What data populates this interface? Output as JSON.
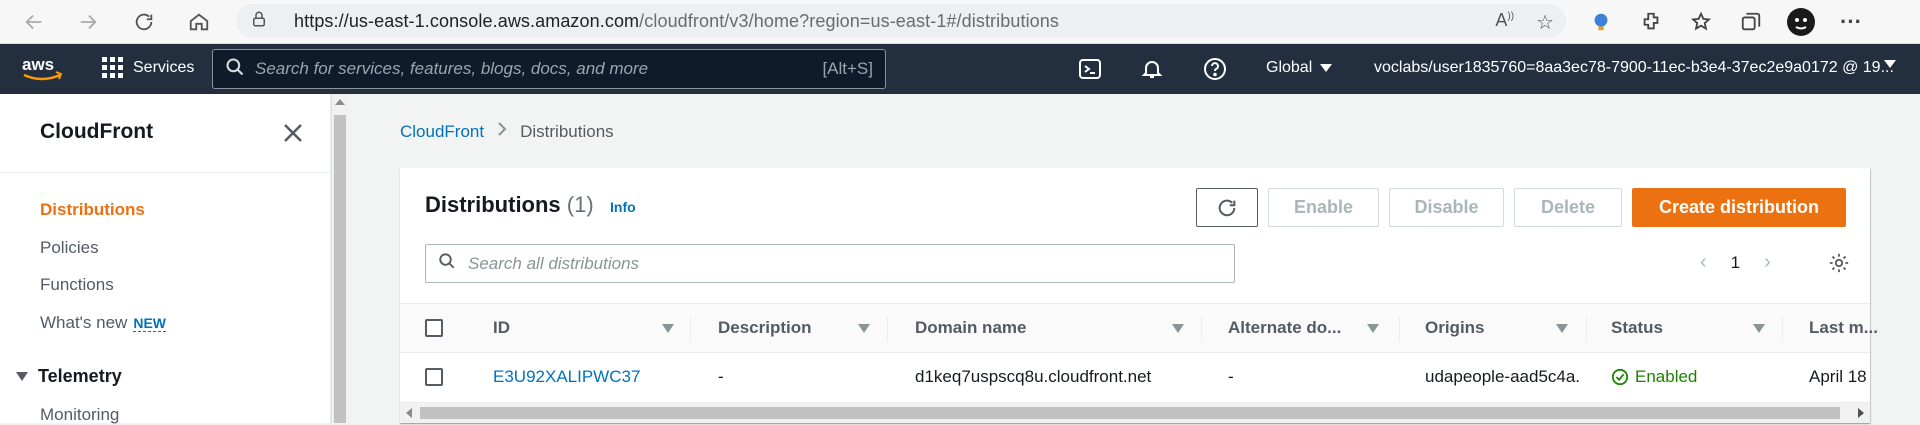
{
  "browser": {
    "url_host": "https://us-east-1.console.aws.amazon.com",
    "url_path": "/cloudfront/v3/home?region=us-east-1#/distributions"
  },
  "aws_header": {
    "services_label": "Services",
    "search_placeholder": "Search for services, features, blogs, docs, and more",
    "search_shortcut": "[Alt+S]",
    "region_label": "Global",
    "account_label": "voclabs/user1835760=8aa3ec78-7900-11ec-b3e4-37ec2e9a0172 @ 19..."
  },
  "sidebar": {
    "title": "CloudFront",
    "items": [
      {
        "label": "Distributions",
        "active": true
      },
      {
        "label": "Policies",
        "active": false
      },
      {
        "label": "Functions",
        "active": false
      },
      {
        "label": "What's new",
        "badge": "NEW",
        "active": false
      }
    ],
    "section_telemetry": "Telemetry",
    "monitoring": "Monitoring"
  },
  "breadcrumb": {
    "root": "CloudFront",
    "current": "Distributions"
  },
  "panel": {
    "title": "Distributions",
    "count": "(1)",
    "info": "Info",
    "buttons": {
      "enable": "Enable",
      "disable": "Disable",
      "delete": "Delete",
      "create": "Create distribution"
    },
    "search_placeholder": "Search all distributions",
    "page": "1"
  },
  "table": {
    "columns": [
      "ID",
      "Description",
      "Domain name",
      "Alternate do...",
      "Origins",
      "Status",
      "Last m..."
    ],
    "rows": [
      {
        "id": "E3U92XALIPWC37",
        "description": "-",
        "domain": "d1keq7uspscq8u.cloudfront.net",
        "alternate": "-",
        "origins": "udapeople-aad5c4a.",
        "status": "Enabled",
        "last_modified": "April 18"
      }
    ]
  },
  "colors": {
    "aws_dark": "#232f3e",
    "accent_orange": "#ec7211",
    "link_blue": "#0073bb",
    "status_green": "#1d8102"
  }
}
